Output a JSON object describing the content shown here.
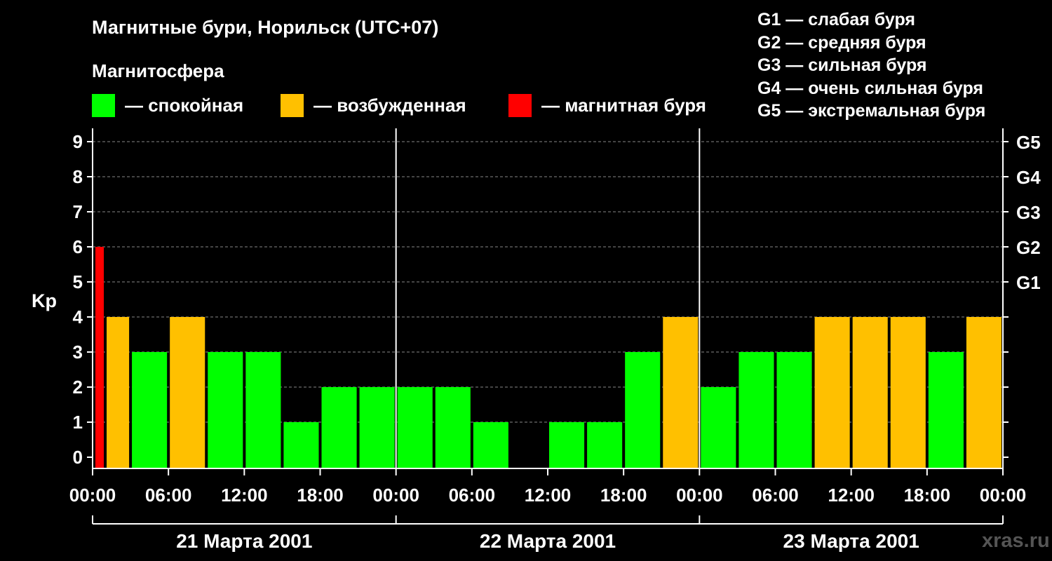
{
  "title": "Магнитные бури, Норильск (UTC+07)",
  "subtitle": "Магнитосфера",
  "legend": [
    {
      "label": "— спокойная",
      "color": "#00ff00"
    },
    {
      "label": "— возбужденная",
      "color": "#ffc000"
    },
    {
      "label": "— магнитная буря",
      "color": "#ff0000"
    }
  ],
  "g_legend": [
    "G1 — слабая буря",
    "G2 — средняя буря",
    "G3 — сильная буря",
    "G4 — очень сильная буря",
    "G5 — экстремальная буря"
  ],
  "watermark": "xras.ru",
  "colors": {
    "quiet": "#00ff00",
    "excited": "#ffc000",
    "storm": "#ff0000",
    "background": "#000000",
    "axis": "#ffffff",
    "grid": "#888888"
  },
  "chart_data": {
    "type": "bar",
    "ylabel": "Kp",
    "ylim": [
      0,
      9
    ],
    "yticks": [
      "0",
      "1",
      "2",
      "3",
      "4",
      "5",
      "6",
      "7",
      "8",
      "9"
    ],
    "right_ticks": [
      {
        "value": 5,
        "label": "G1"
      },
      {
        "value": 6,
        "label": "G2"
      },
      {
        "value": 7,
        "label": "G3"
      },
      {
        "value": 8,
        "label": "G4"
      },
      {
        "value": 9,
        "label": "G5"
      }
    ],
    "xticks": [
      "00:00",
      "06:00",
      "12:00",
      "18:00",
      "00:00",
      "06:00",
      "12:00",
      "18:00",
      "00:00",
      "06:00",
      "12:00",
      "18:00",
      "00:00"
    ],
    "days": [
      "21 Марта 2001",
      "22 Марта 2001",
      "23 Марта 2001"
    ],
    "grid": true,
    "interval_hours": 3,
    "bars": [
      {
        "start_hour": 0,
        "end_hour": 1,
        "kp": 6,
        "level": "storm"
      },
      {
        "start_hour": 1,
        "end_hour": 3,
        "kp": 4,
        "level": "excited"
      },
      {
        "start_hour": 3,
        "end_hour": 6,
        "kp": 3,
        "level": "quiet"
      },
      {
        "start_hour": 6,
        "end_hour": 9,
        "kp": 4,
        "level": "excited"
      },
      {
        "start_hour": 9,
        "end_hour": 12,
        "kp": 3,
        "level": "quiet"
      },
      {
        "start_hour": 12,
        "end_hour": 15,
        "kp": 3,
        "level": "quiet"
      },
      {
        "start_hour": 15,
        "end_hour": 18,
        "kp": 1,
        "level": "quiet"
      },
      {
        "start_hour": 18,
        "end_hour": 21,
        "kp": 2,
        "level": "quiet"
      },
      {
        "start_hour": 21,
        "end_hour": 24,
        "kp": 2,
        "level": "quiet"
      },
      {
        "start_hour": 24,
        "end_hour": 27,
        "kp": 2,
        "level": "quiet"
      },
      {
        "start_hour": 27,
        "end_hour": 30,
        "kp": 2,
        "level": "quiet"
      },
      {
        "start_hour": 30,
        "end_hour": 33,
        "kp": 1,
        "level": "quiet"
      },
      {
        "start_hour": 33,
        "end_hour": 36,
        "kp": 0,
        "level": "quiet"
      },
      {
        "start_hour": 36,
        "end_hour": 39,
        "kp": 1,
        "level": "quiet"
      },
      {
        "start_hour": 39,
        "end_hour": 42,
        "kp": 1,
        "level": "quiet"
      },
      {
        "start_hour": 42,
        "end_hour": 45,
        "kp": 3,
        "level": "quiet"
      },
      {
        "start_hour": 45,
        "end_hour": 48,
        "kp": 4,
        "level": "excited"
      },
      {
        "start_hour": 48,
        "end_hour": 51,
        "kp": 2,
        "level": "quiet"
      },
      {
        "start_hour": 51,
        "end_hour": 54,
        "kp": 3,
        "level": "quiet"
      },
      {
        "start_hour": 54,
        "end_hour": 57,
        "kp": 3,
        "level": "quiet"
      },
      {
        "start_hour": 57,
        "end_hour": 60,
        "kp": 4,
        "level": "excited"
      },
      {
        "start_hour": 60,
        "end_hour": 63,
        "kp": 4,
        "level": "excited"
      },
      {
        "start_hour": 63,
        "end_hour": 66,
        "kp": 4,
        "level": "excited"
      },
      {
        "start_hour": 66,
        "end_hour": 69,
        "kp": 3,
        "level": "quiet"
      },
      {
        "start_hour": 69,
        "end_hour": 72,
        "kp": 4,
        "level": "excited"
      }
    ]
  }
}
